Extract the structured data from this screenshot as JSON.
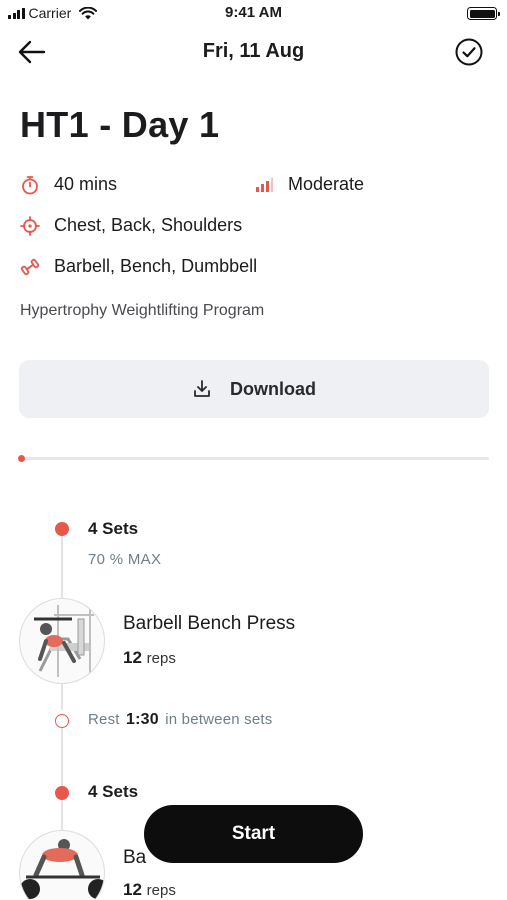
{
  "status_bar": {
    "carrier": "Carrier",
    "time": "9:41 AM"
  },
  "nav": {
    "title": "Fri, 11 Aug",
    "back_icon": "arrow-left-icon",
    "done_icon": "check-circle-icon"
  },
  "workout": {
    "title": "HT1 - Day 1",
    "duration": "40 mins",
    "intensity_label": "Moderate",
    "muscles": "Chest, Back, Shoulders",
    "equipment": "Barbell, Bench, Dumbbell",
    "program": "Hypertrophy Weightlifting Program"
  },
  "download": {
    "label": "Download",
    "icon": "download-icon"
  },
  "progress": {
    "fraction": 0.0
  },
  "blocks": [
    {
      "sets": "4 Sets",
      "load": "70 % MAX",
      "exercise": "Barbell Bench Press",
      "reps_count": "12",
      "reps_unit": "reps",
      "rest_label": "Rest",
      "rest_time": "1:30",
      "rest_suffix": "in between sets"
    },
    {
      "sets": "4 Sets",
      "exercise_partial": "Ba",
      "reps_count": "12",
      "reps_unit": "reps"
    }
  ],
  "start_button": {
    "label": "Start"
  },
  "colors": {
    "accent": "#e8574b",
    "muted": "#6f7e88",
    "button_dark": "#0d0d0d",
    "download_bg": "#eef0f3"
  }
}
